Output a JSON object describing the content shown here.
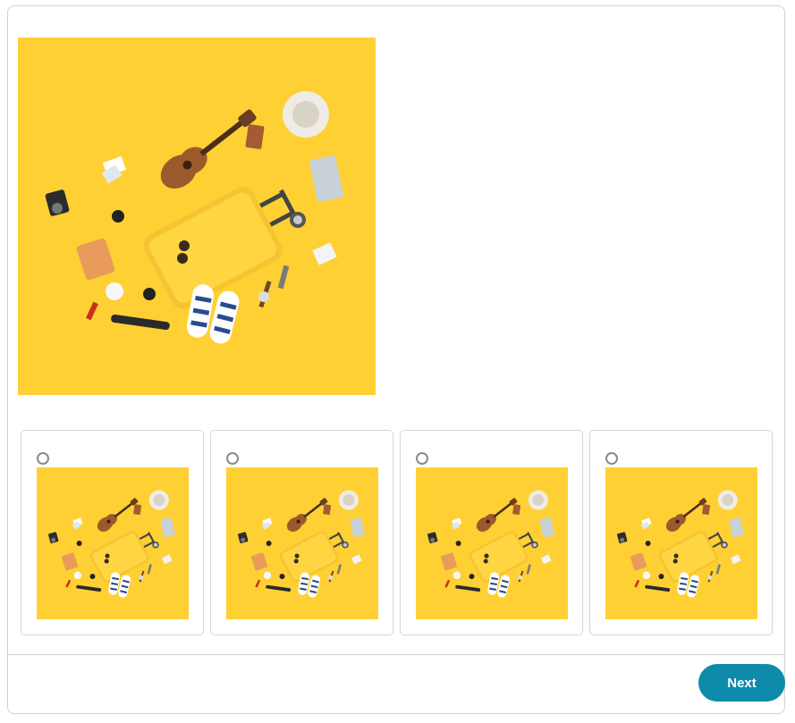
{
  "main": {
    "image": {
      "icon": "travel-flatlay-image",
      "background_color": "#FFD033"
    }
  },
  "options": [
    {
      "selected": false
    },
    {
      "selected": false
    },
    {
      "selected": false
    },
    {
      "selected": false
    }
  ],
  "footer": {
    "next_label": "Next"
  },
  "colors": {
    "accent": "#0E8BAB",
    "border": "#D2D2D2",
    "radio": "#8A8A8A"
  }
}
